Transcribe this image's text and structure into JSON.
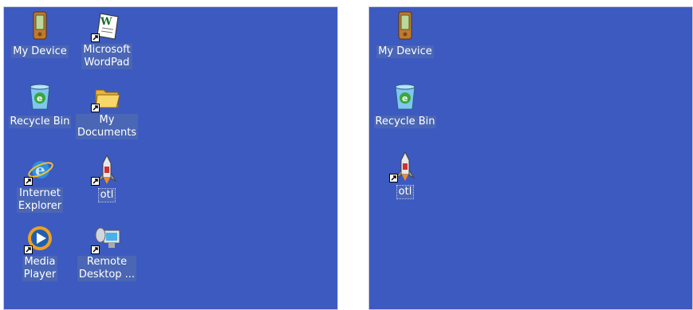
{
  "left_desktop": {
    "icons": [
      {
        "name": "My Device",
        "icon": "pda-device-icon"
      },
      {
        "name": "Microsoft\nWordPad",
        "icon": "wordpad-icon",
        "shortcut": true
      },
      {
        "name": "Recycle Bin",
        "icon": "recycle-bin-icon"
      },
      {
        "name": "My\nDocuments",
        "icon": "folder-icon",
        "shortcut": true
      },
      {
        "name": "Internet\nExplorer",
        "icon": "internet-explorer-icon",
        "shortcut": true
      },
      {
        "name": "otl",
        "icon": "rocket-app-icon",
        "shortcut": true
      },
      {
        "name": "Media\nPlayer",
        "icon": "media-player-icon",
        "shortcut": true
      },
      {
        "name": "Remote\nDesktop ...",
        "icon": "remote-desktop-icon",
        "shortcut": true
      }
    ]
  },
  "right_desktop": {
    "icons": [
      {
        "name": "My Device",
        "icon": "pda-device-icon"
      },
      {
        "name": "Recycle Bin",
        "icon": "recycle-bin-icon"
      },
      {
        "name": "otl",
        "icon": "rocket-app-icon",
        "shortcut": true
      }
    ]
  },
  "colors": {
    "desktop": "#3d5ac0",
    "label_highlight": "#4a66b4"
  }
}
